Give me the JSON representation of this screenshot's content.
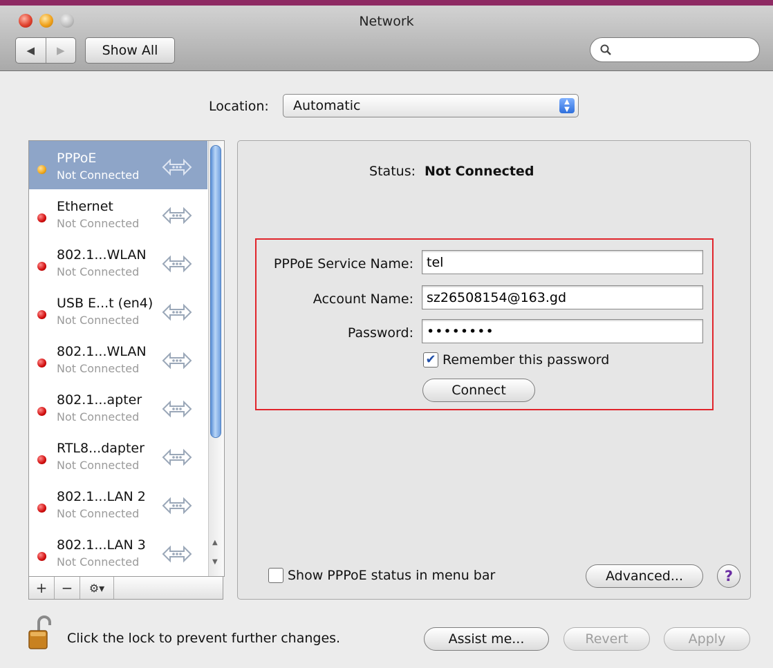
{
  "window": {
    "title": "Network"
  },
  "toolbar": {
    "back_icon": "◀",
    "forward_icon": "▶",
    "show_all_label": "Show All",
    "search_placeholder": "",
    "search_icon": "search-icon"
  },
  "location": {
    "label": "Location:",
    "value": "Automatic"
  },
  "services": [
    {
      "name": "PPPoE",
      "status": "Not Connected",
      "status_color": "yellow",
      "selected": true
    },
    {
      "name": "Ethernet",
      "status": "Not Connected",
      "status_color": "red",
      "selected": false
    },
    {
      "name": "802.1...WLAN",
      "status": "Not Connected",
      "status_color": "red",
      "selected": false
    },
    {
      "name": "USB E...t (en4)",
      "status": "Not Connected",
      "status_color": "red",
      "selected": false
    },
    {
      "name": "802.1...WLAN",
      "status": "Not Connected",
      "status_color": "red",
      "selected": false
    },
    {
      "name": "802.1...apter",
      "status": "Not Connected",
      "status_color": "red",
      "selected": false
    },
    {
      "name": "RTL8...dapter",
      "status": "Not Connected",
      "status_color": "red",
      "selected": false
    },
    {
      "name": "802.1...LAN 2",
      "status": "Not Connected",
      "status_color": "red",
      "selected": false
    },
    {
      "name": "802.1...LAN 3",
      "status": "Not Connected",
      "status_color": "red",
      "selected": false
    }
  ],
  "list_toolbar": {
    "add": "+",
    "remove": "−",
    "gear": "⚙▾"
  },
  "detail": {
    "status_label": "Status:",
    "status_value": "Not Connected",
    "service_name_label": "PPPoE Service Name:",
    "service_name_value": "tel",
    "account_label": "Account Name:",
    "account_value": "sz26508154@163.gd",
    "password_label": "Password:",
    "password_value": "••••••••",
    "remember_label": "Remember this password",
    "remember_checked": true,
    "connect_label": "Connect",
    "menubar_label": "Show PPPoE status in menu bar",
    "menubar_checked": false,
    "advanced_label": "Advanced...",
    "help_label": "?"
  },
  "footer": {
    "lock_text": "Click the lock to prevent further changes.",
    "assist_label": "Assist me...",
    "revert_label": "Revert",
    "apply_label": "Apply"
  },
  "colors": {
    "selected_row": "#8ea5c8",
    "highlight_box": "#e0242b",
    "status_red": "#d10d0d",
    "status_yellow": "#f1a81b"
  }
}
